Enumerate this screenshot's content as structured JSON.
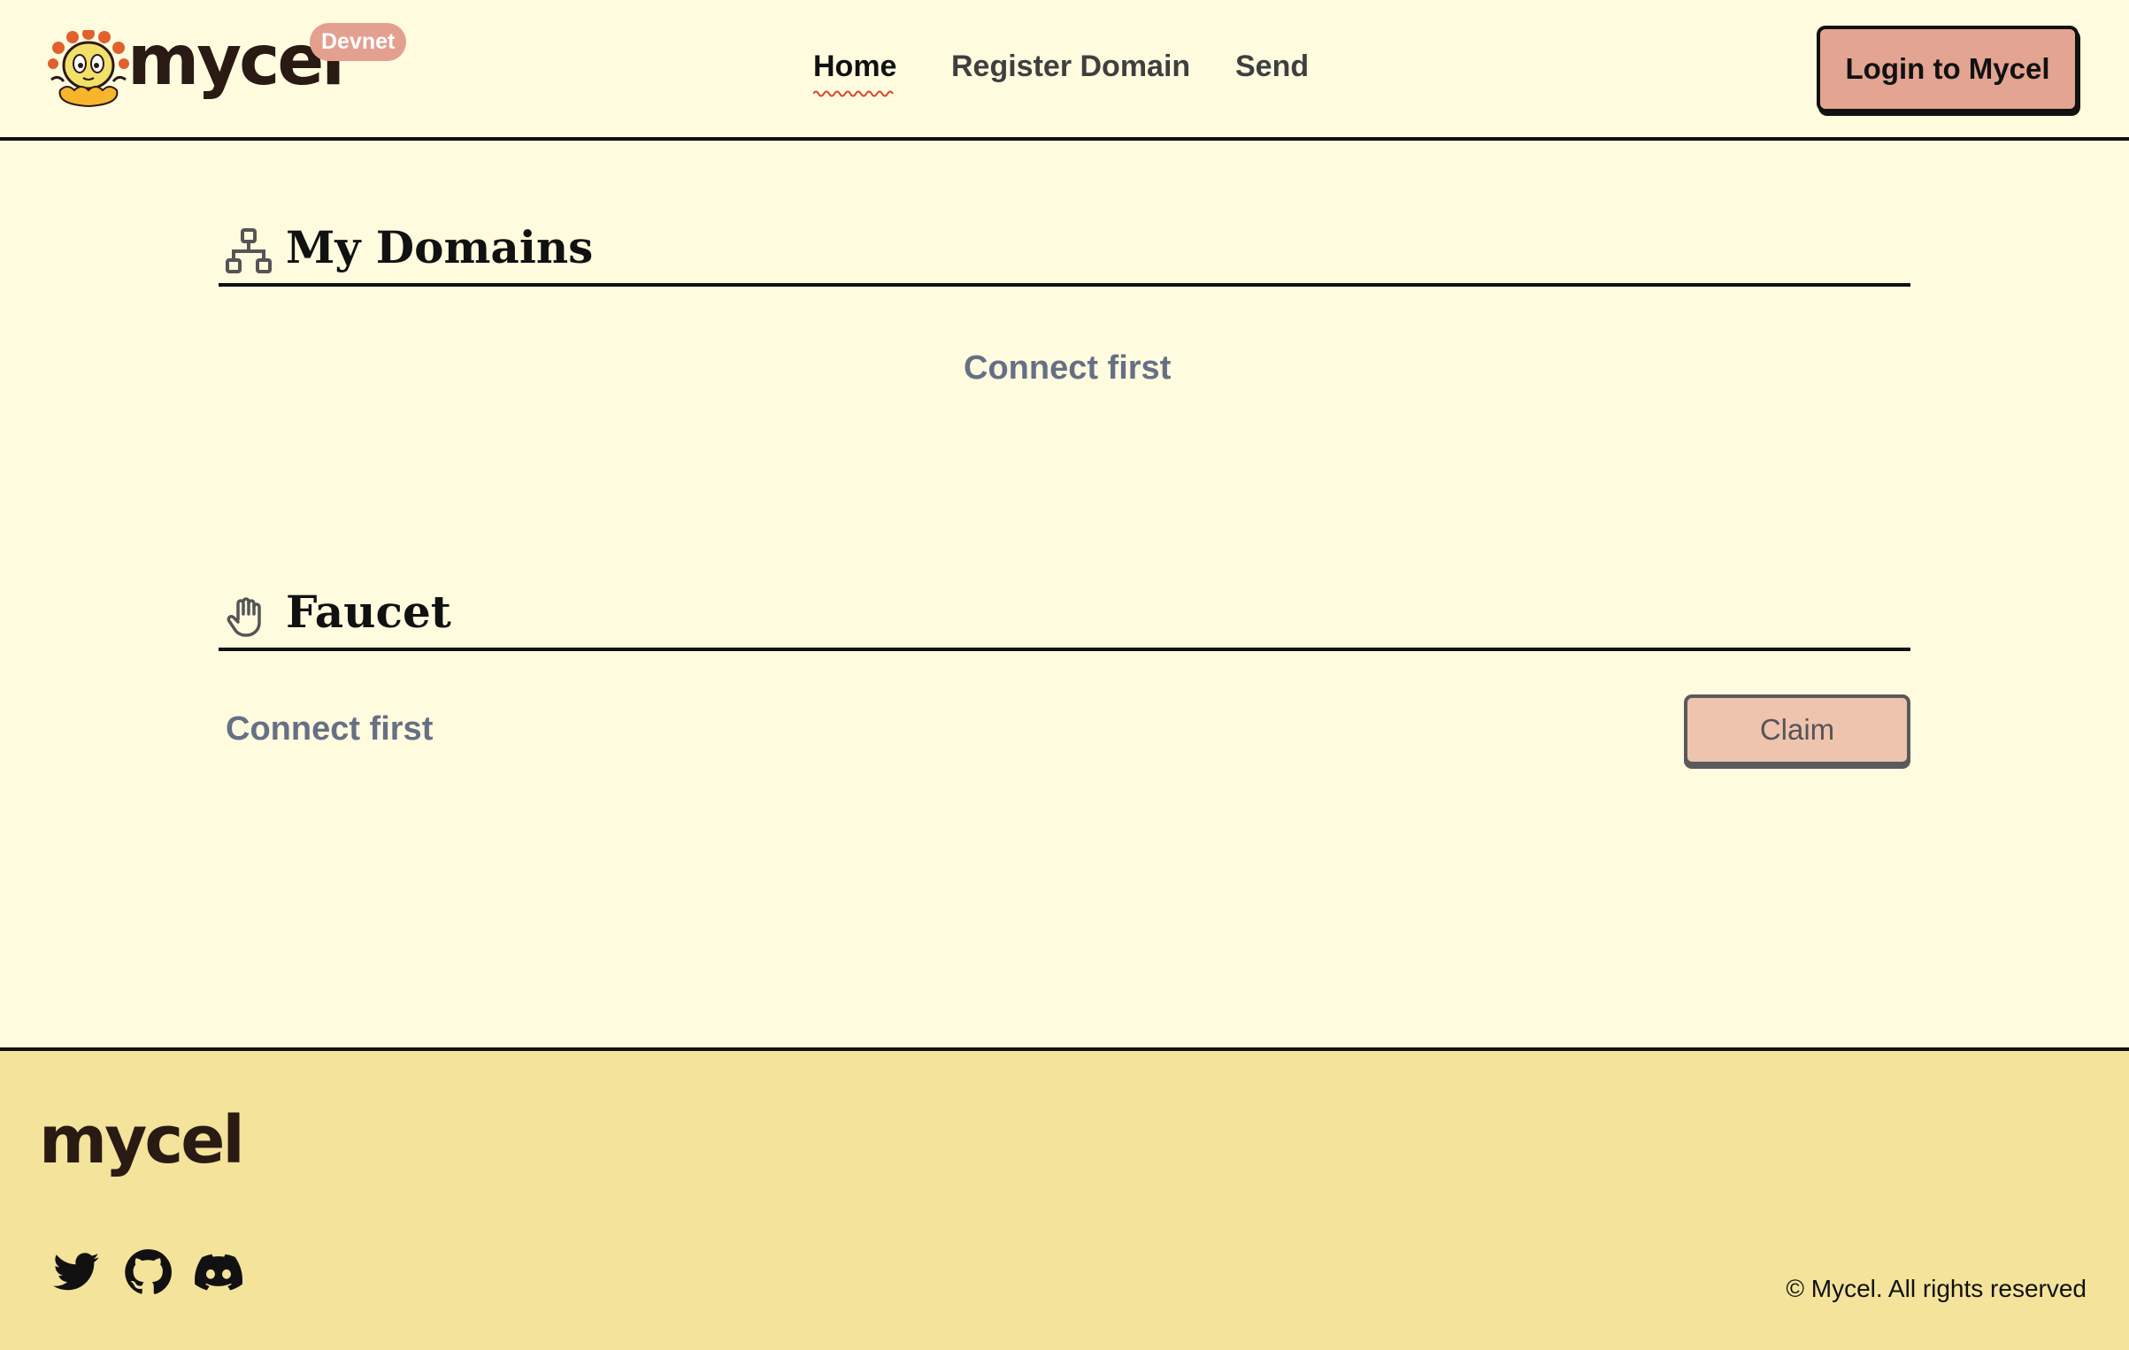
{
  "header": {
    "brand": "mycel",
    "badge": "Devnet",
    "nav": [
      {
        "label": "Home"
      },
      {
        "label": "Register Domain"
      },
      {
        "label": "Send"
      }
    ],
    "login_label": "Login to Mycel"
  },
  "domains": {
    "title": "My Domains",
    "status": "Connect first"
  },
  "faucet": {
    "title": "Faucet",
    "status": "Connect first",
    "claim_label": "Claim"
  },
  "footer": {
    "brand": "mycel",
    "copyright": "© Mycel. All rights reserved",
    "social_icons": [
      "twitter-icon",
      "github-icon",
      "discord-icon"
    ]
  },
  "colors": {
    "background": "#fefbdf",
    "accent": "#e3a491",
    "footer": "#f3e39b",
    "muted_text": "#667085"
  }
}
